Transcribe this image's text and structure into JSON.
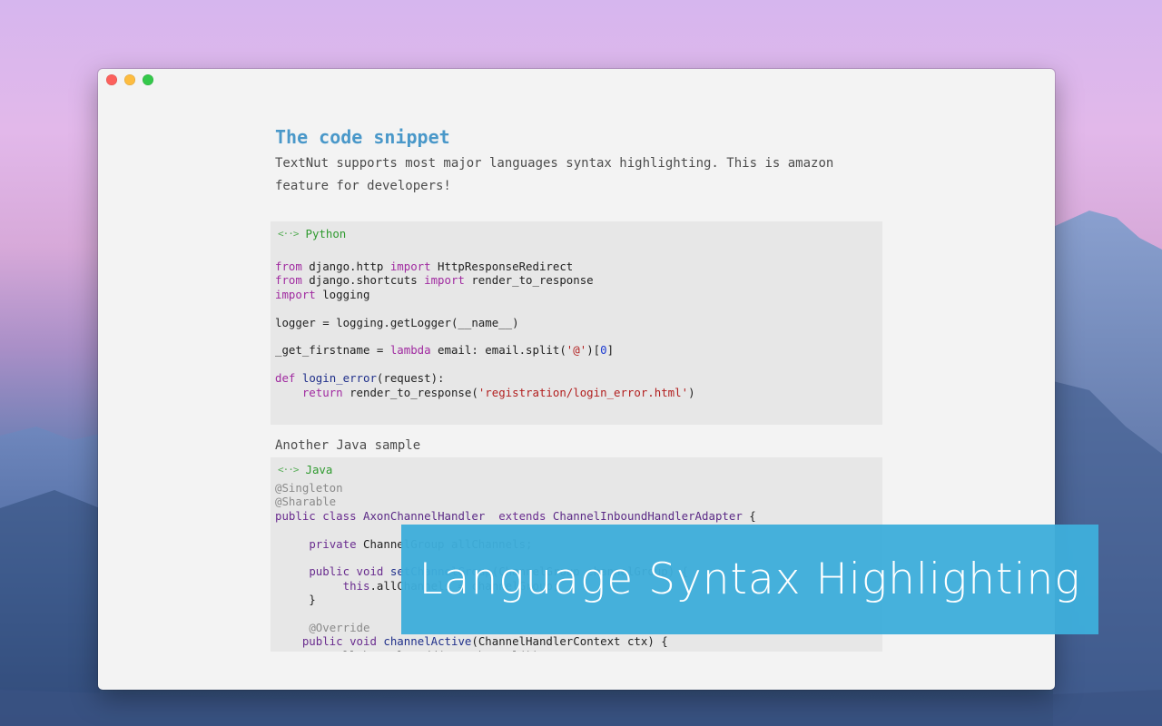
{
  "window": {
    "traffic_lights": {
      "close_color": "#fc605c",
      "minimize_color": "#fdbc40",
      "maximize_color": "#34c84a"
    }
  },
  "document": {
    "heading": "The code snippet",
    "intro": "TextNut supports most major languages syntax highlighting. This is amazon feature for developers!",
    "python_block": {
      "language": "Python",
      "icon": "code-brackets-icon",
      "lines": [
        "from django.http import HttpResponseRedirect",
        "from django.shortcuts import render_to_response",
        "import logging",
        "",
        "logger = logging.getLogger(__name__)",
        "",
        "_get_firstname = lambda email: email.split('@')[0]",
        "",
        "def login_error(request):",
        "    return render_to_response('registration/login_error.html')"
      ]
    },
    "java_heading": "Another Java sample",
    "java_block": {
      "language": "Java",
      "icon": "code-brackets-icon",
      "lines": [
        "@Singleton",
        "@Sharable",
        "public class AxonChannelHandler  extends ChannelInboundHandlerAdapter {",
        "",
        "     private ChannelGroup allChannels;",
        "",
        "     public void setChannelGroup(ChannelGroup channelGroup) {",
        "          this.allChannels = channelGroup;",
        "     }",
        "",
        "     @Override",
        "    public void channelActive(ChannelHandlerContext ctx) {",
        "         allChannels.add(ctx.channel());"
      ]
    }
  },
  "banner": {
    "text": "Language Syntax Highlighting",
    "color": "#3eaedb"
  }
}
